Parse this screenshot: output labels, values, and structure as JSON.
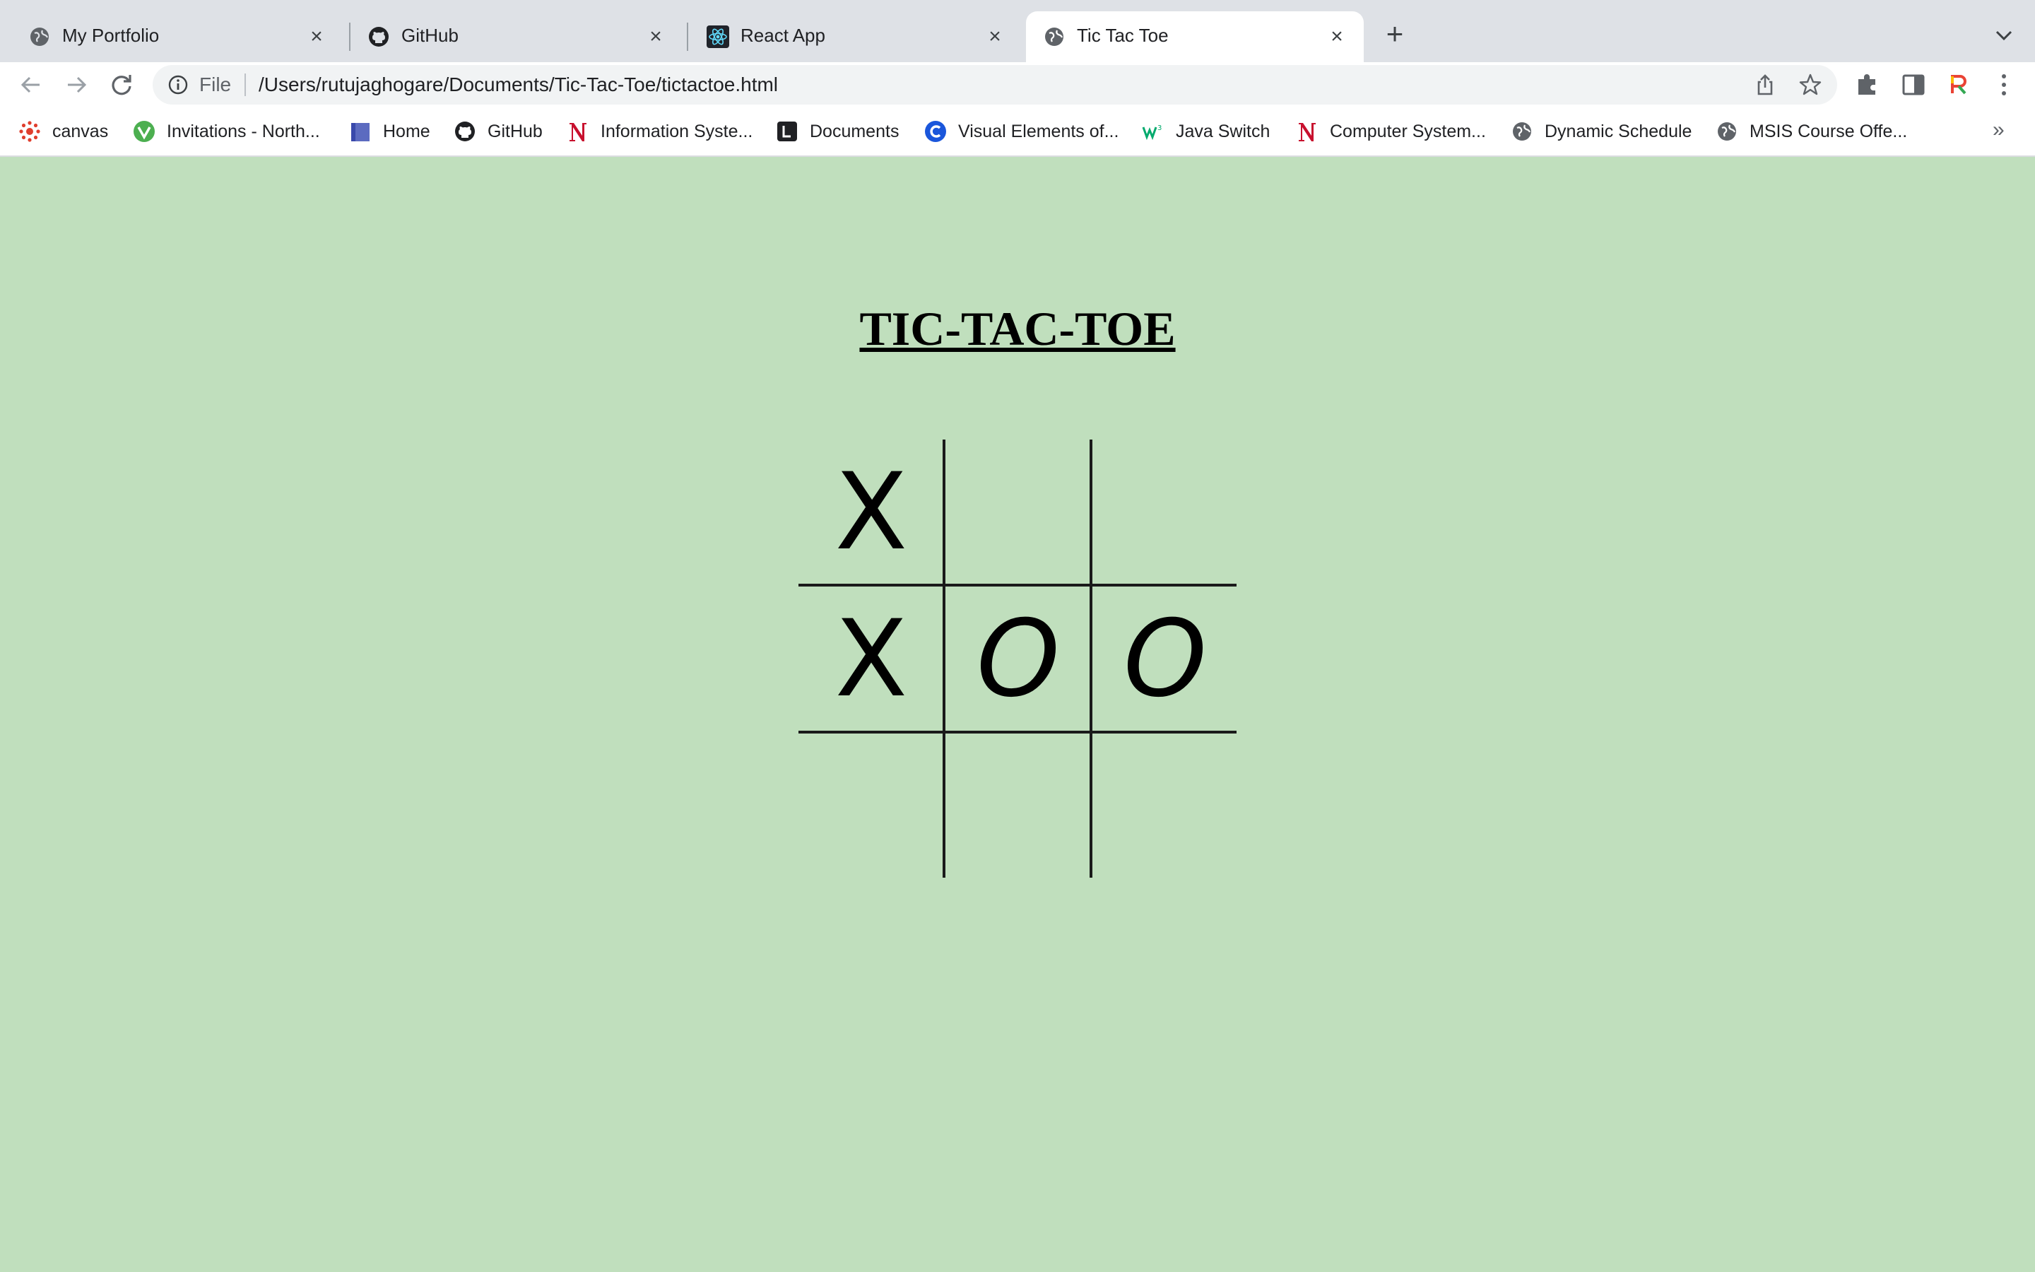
{
  "browser": {
    "tabs": [
      {
        "title": "My Portfolio",
        "icon": "globe-icon",
        "active": false
      },
      {
        "title": "GitHub",
        "icon": "github-icon",
        "active": false
      },
      {
        "title": "React App",
        "icon": "react-icon",
        "active": false
      },
      {
        "title": "Tic Tac Toe",
        "icon": "globe-icon",
        "active": true
      }
    ],
    "new_tab_label": "+",
    "address": {
      "scheme_label": "File",
      "url": "/Users/rutujaghogare/Documents/Tic-Tac-Toe/tictactoe.html"
    },
    "bookmarks": [
      {
        "label": "canvas",
        "icon": "canvas-icon"
      },
      {
        "label": "Invitations - North...",
        "icon": "invitations-icon"
      },
      {
        "label": "Home",
        "icon": "book-icon"
      },
      {
        "label": "GitHub",
        "icon": "github-icon"
      },
      {
        "label": "Information Syste...",
        "icon": "northeastern-icon"
      },
      {
        "label": "Documents",
        "icon": "documents-icon"
      },
      {
        "label": "Visual Elements of...",
        "icon": "c-icon"
      },
      {
        "label": "Java Switch",
        "icon": "w3schools-icon"
      },
      {
        "label": "Computer System...",
        "icon": "northeastern-icon"
      },
      {
        "label": "Dynamic Schedule",
        "icon": "globe-icon"
      },
      {
        "label": "MSIS Course Offe...",
        "icon": "globe-icon"
      }
    ],
    "bookmarks_overflow": "»"
  },
  "page": {
    "title": "TIC-TAC-TOE",
    "background": "#c0dfbd",
    "board": {
      "cells": [
        "X",
        "",
        "",
        "X",
        "O",
        "O",
        "",
        "",
        ""
      ]
    }
  }
}
